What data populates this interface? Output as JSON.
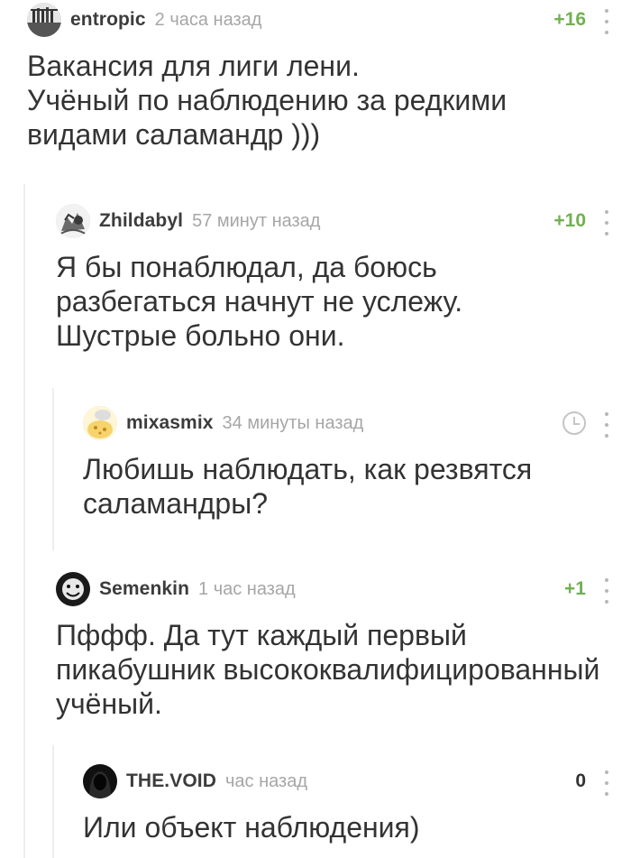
{
  "comments": [
    {
      "username": "entropic",
      "time": "2 часа назад",
      "rating": "+16",
      "text": "Вакансия для лиги лени.\nУчёный по наблюдению за редкими видами саламандр )))",
      "avatar_icon": "avatar-entropic-icon"
    },
    {
      "username": "Zhildabyl",
      "time": "57 минут назад",
      "rating": "+10",
      "text": "Я бы понаблюдал, да боюсь разбегаться начнут не услежу. Шустрые больно они.",
      "avatar_icon": "avatar-zhildabyl-icon"
    },
    {
      "username": "mixasmix",
      "time": "34 минуты назад",
      "rating": "",
      "text": "Любишь наблюдать, как резвятся саламандры?",
      "avatar_icon": "avatar-mixasmix-icon"
    },
    {
      "username": "Semenkin",
      "time": "1 час назад",
      "rating": "+1",
      "text": "Пффф. Да тут каждый первый пикабушник высококвалифицированный учёный.",
      "avatar_icon": "avatar-semenkin-icon"
    },
    {
      "username": "THE.VOID",
      "time": "час назад",
      "rating": "0",
      "text": "Или объект наблюдения)",
      "avatar_icon": "avatar-thevoid-icon"
    }
  ],
  "colors": {
    "positive_rating": "#72b051",
    "neutral_rating": "#333333",
    "time": "#a6a6a6",
    "username": "#3c3c3c"
  }
}
